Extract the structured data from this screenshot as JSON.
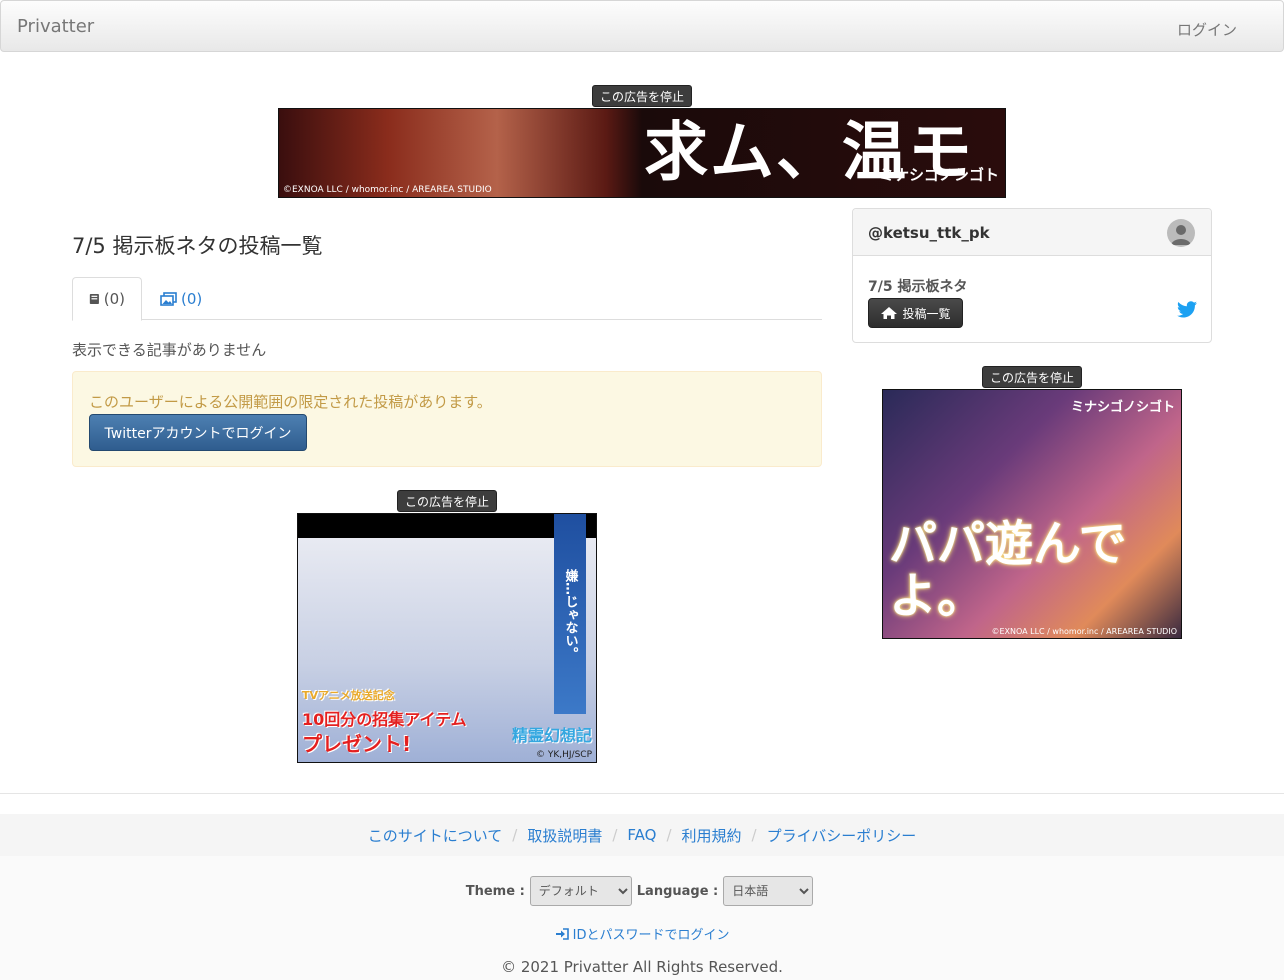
{
  "navbar": {
    "brand": "Privatter",
    "login": "ログイン"
  },
  "ads": {
    "stop_label": "この広告を停止"
  },
  "top_banner": {
    "headline": "求ム、温モリ。",
    "logo": "ミナシゴノシゴト",
    "credit": "©EXNOA LLC / whomor.inc / AREAREA STUDIO"
  },
  "main": {
    "title": "7/5 掲示板ネタの投稿一覧",
    "tabs": [
      {
        "label": "(0)",
        "icon": "book-icon"
      },
      {
        "label": "(0)",
        "icon": "images-icon"
      }
    ],
    "empty_text": "表示できる記事がありません",
    "alert": {
      "text": "このユーザーによる公開範囲の限定された投稿があります。",
      "button": "Twitterアカウントでログイン"
    }
  },
  "mid_banner": {
    "vertical_text": "嫌…じゃない。",
    "promo_line1": "TVアニメ放送記念",
    "promo_line2": "10回分の招集アイテム",
    "promo_line3": "プレゼント!",
    "game": "精霊幻想記",
    "credit": "© YK,HJ/SCP"
  },
  "sidebar": {
    "username": "@ketsu_ttk_pk",
    "topic": "7/5 掲示板ネタ",
    "posts_button": "投稿一覧"
  },
  "side_banner": {
    "headline": "パパ遊んでよ。",
    "logo": "ミナシゴノシゴト",
    "credit": "©EXNOA LLC / whomor.inc / AREAREA STUDIO"
  },
  "footer": {
    "links": [
      "このサイトについて",
      "取扱説明書",
      "FAQ",
      "利用規約",
      "プライバシーポリシー"
    ],
    "theme_label": "Theme :",
    "theme_value": "デフォルト",
    "language_label": "Language :",
    "language_value": "日本語",
    "id_login": "IDとパスワードでログイン",
    "copyright": "© 2021 Privatter All Rights Reserved."
  },
  "colors": {
    "link": "#2a7ed0",
    "alert_bg": "#fcf8e3",
    "alert_text": "#c29a46",
    "twitter_btn": "#3a6a9c"
  }
}
